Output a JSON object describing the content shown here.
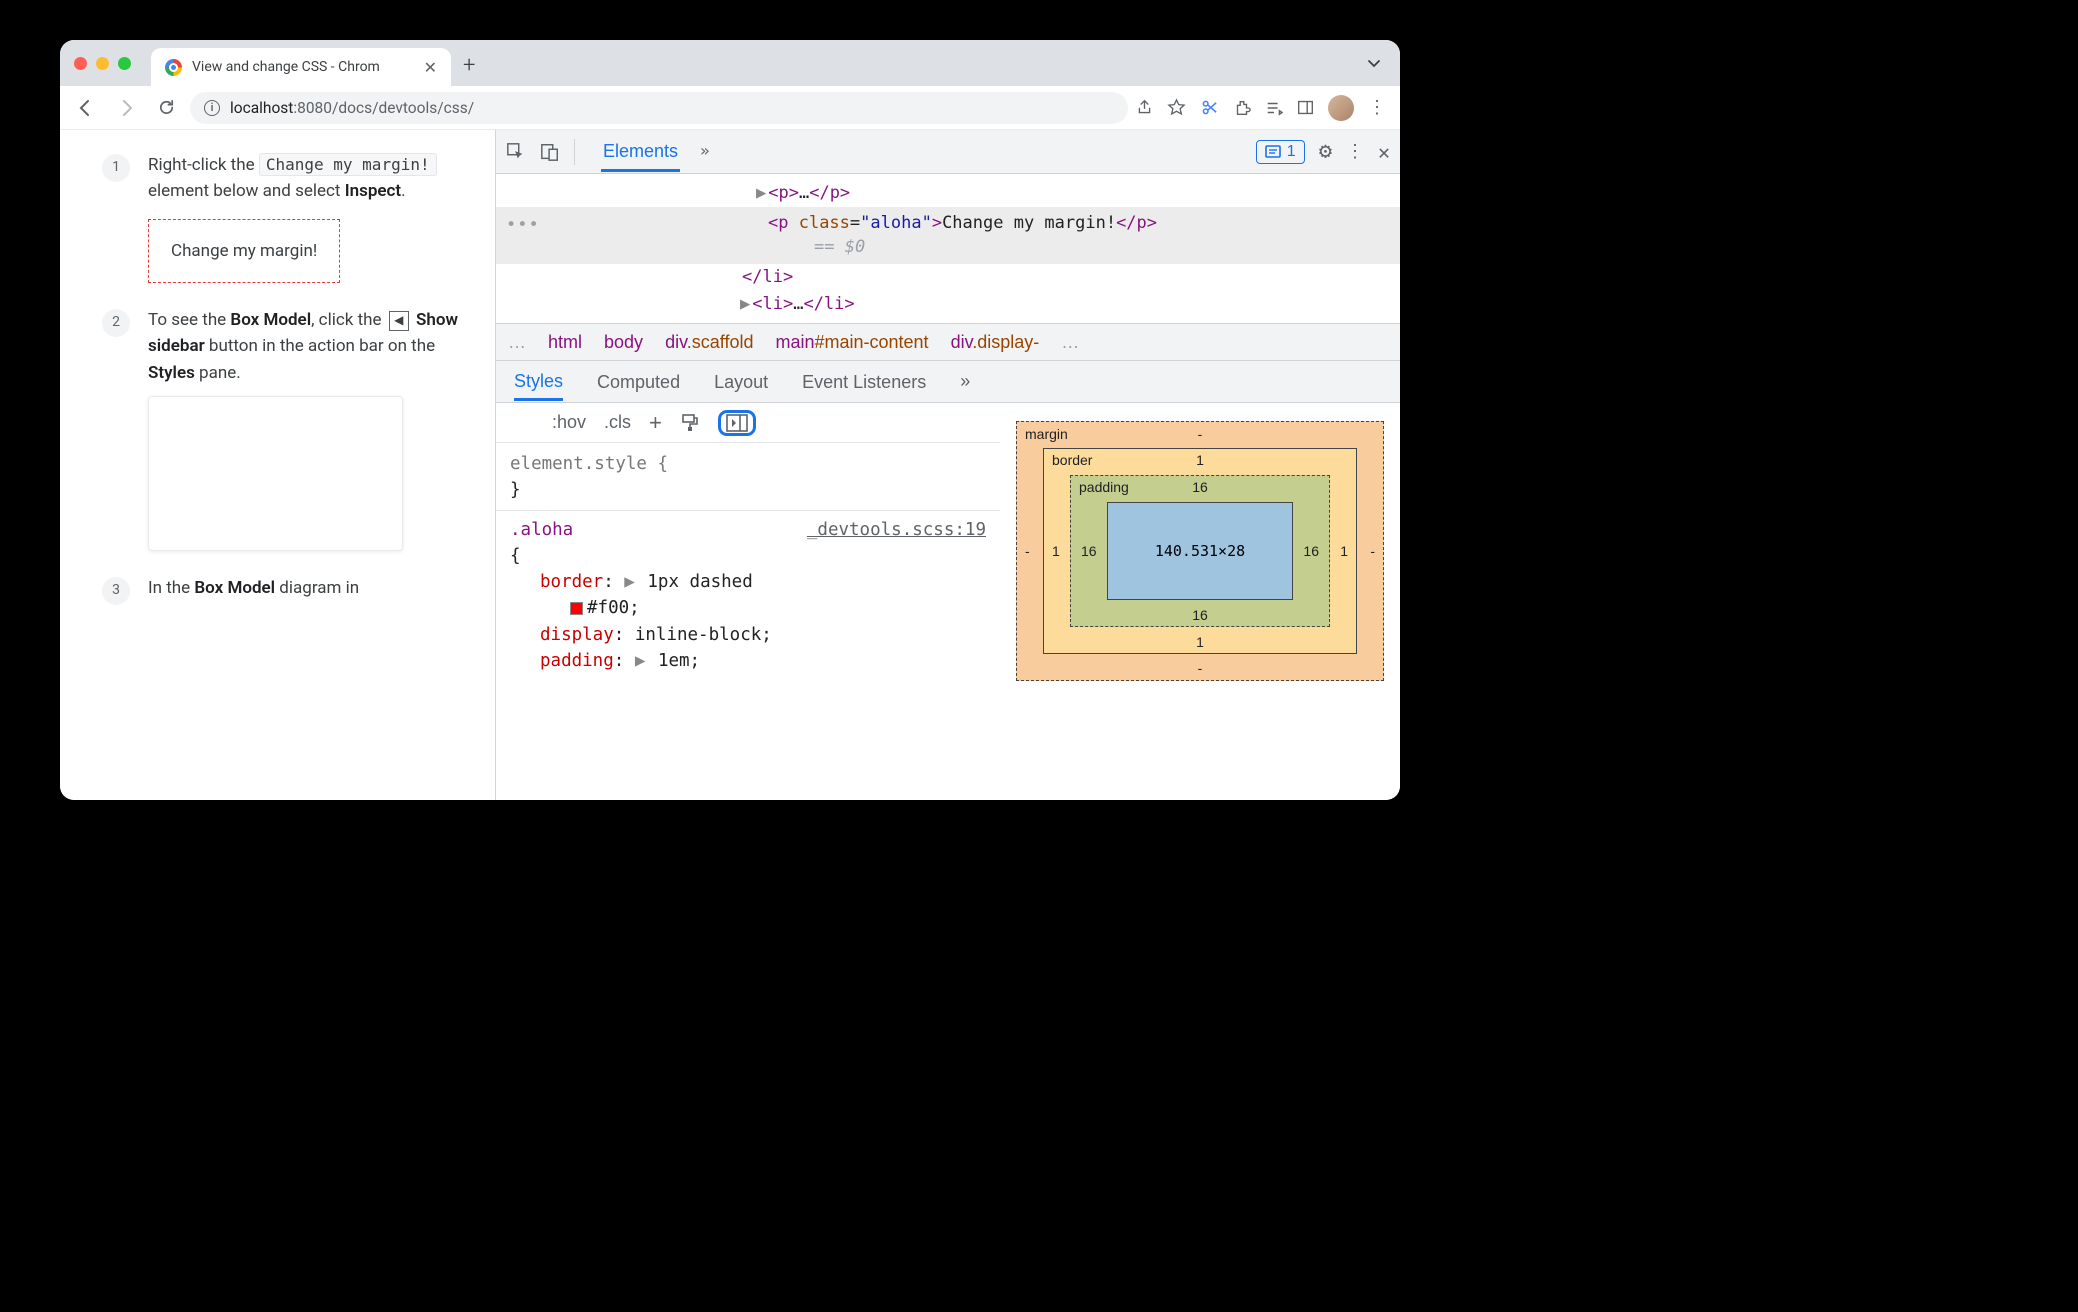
{
  "browser": {
    "tab_title": "View and change CSS - Chrom",
    "url_host": "localhost",
    "url_port": ":8080",
    "url_path": "/docs/devtools/css/"
  },
  "page": {
    "steps": [
      {
        "num": "1",
        "pre": "Right-click the ",
        "code": "Change my margin!",
        "mid": " element below and select ",
        "bold": "Inspect",
        "post": "."
      },
      {
        "num": "2",
        "pre": "To see the ",
        "bold1": "Box Model",
        "mid1": ", click the ",
        "bold2": "Show sidebar",
        "mid2": " button in the action bar on the ",
        "bold3": "Styles",
        "post": " pane."
      },
      {
        "num": "3",
        "pre": "In the ",
        "bold": "Box Model",
        "post": " diagram in"
      }
    ],
    "demo_text": "Change my margin!"
  },
  "devtools": {
    "main_tab": "Elements",
    "issues_count": "1",
    "dom": {
      "l1": "<p>…</p>",
      "sel_open": "<p class=\"aloha\">",
      "sel_text": "Change my margin!",
      "sel_close": "</p>",
      "sel_suffix": "== $0",
      "l3": "</li>",
      "l4": "<li>…</li>"
    },
    "crumbs": [
      "html",
      "body",
      "div.scaffold",
      "main#main-content",
      "div.display-"
    ],
    "style_tabs": [
      "Styles",
      "Computed",
      "Layout",
      "Event Listeners"
    ],
    "rulebar": {
      "hov": ":hov",
      "cls": ".cls"
    },
    "rules": {
      "element_style": "element.style {",
      "element_close": "}",
      "selector": ".aloha",
      "source": "_devtools.scss:19",
      "open": "{",
      "border_prop": "border",
      "border_val": "1px dashed",
      "border_color": "#f00",
      "display_prop": "display",
      "display_val": "inline-block",
      "padding_prop": "padding",
      "padding_val": "1em"
    },
    "box": {
      "margin_label": "margin",
      "border_label": "border",
      "padding_label": "padding",
      "content": "140.531×28",
      "margin": {
        "t": "-",
        "r": "-",
        "b": "-",
        "l": "-"
      },
      "border": {
        "t": "1",
        "r": "1",
        "b": "1",
        "l": "1"
      },
      "padding": {
        "t": "16",
        "r": "16",
        "b": "16",
        "l": "16"
      }
    }
  }
}
